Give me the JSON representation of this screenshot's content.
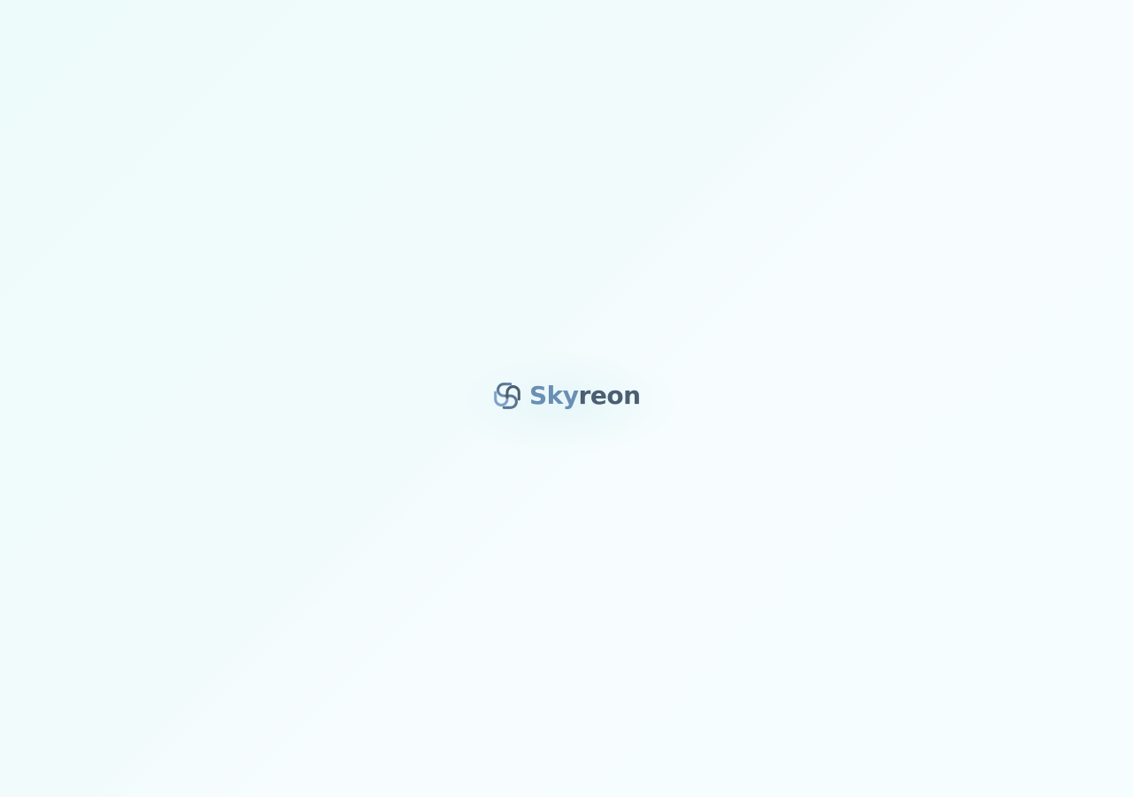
{
  "brand": {
    "name_part_1": "Sky",
    "name_part_2": "reon",
    "logo_icon": "interlocking-links-icon",
    "colors": {
      "accent": "#6a8fb5",
      "dark": "#4b5e72",
      "background": "#f2fbfc"
    }
  }
}
